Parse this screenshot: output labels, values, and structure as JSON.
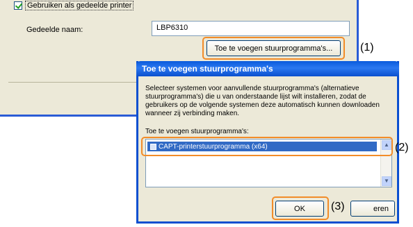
{
  "background_window": {
    "share_checkbox_label": "Gebruiken als gedeelde printer",
    "share_name_label": "Gedeelde naam:",
    "share_name_value": "LBP6310",
    "additional_drivers_button": "Toe te voegen stuurprogramma's..."
  },
  "dialog": {
    "title": "Toe te voegen stuurprogramma's",
    "description": "Selecteer systemen voor aanvullende stuurprogramma's (alternatieve stuurprogramma's) die u van onderstaande lijst wilt installeren, zodat de gebruikers op de volgende systemen deze automatisch kunnen downloaden wanneer zij verbinding maken.",
    "list_label": "Toe te voegen stuurprogramma's:",
    "list_items": [
      "CAPT-printerstuurprogramma (x64)"
    ],
    "ok_button": "OK",
    "cancel_button_visible": "eren"
  },
  "steps": [
    "(1)",
    "(2)",
    "(3)"
  ],
  "colors": {
    "highlight": "#f28c28",
    "titlebar": "#0a5bdc",
    "selection": "#316ac5",
    "window_face": "#ece9d8"
  }
}
